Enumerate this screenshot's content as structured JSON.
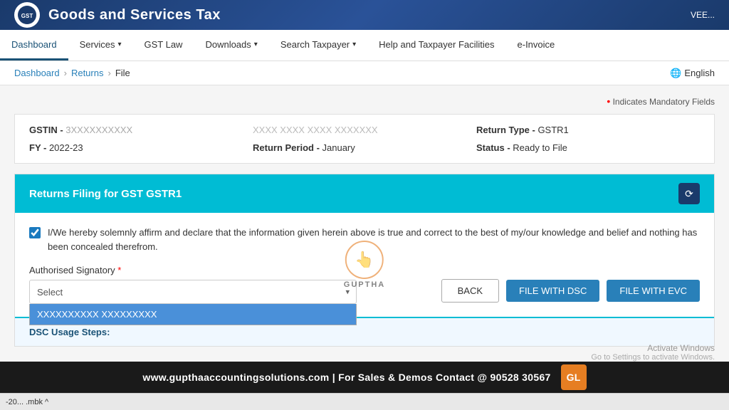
{
  "header": {
    "logo_text": "GST",
    "title": "Goods and Services Tax",
    "user_text": "VEE..."
  },
  "nav": {
    "items": [
      {
        "label": "Dashboard",
        "active": true,
        "has_arrow": false
      },
      {
        "label": "Services",
        "active": false,
        "has_arrow": true
      },
      {
        "label": "GST Law",
        "active": false,
        "has_arrow": false
      },
      {
        "label": "Downloads",
        "active": false,
        "has_arrow": true
      },
      {
        "label": "Search Taxpayer",
        "active": false,
        "has_arrow": true
      },
      {
        "label": "Help and Taxpayer Facilities",
        "active": false,
        "has_arrow": false
      },
      {
        "label": "e-Invoice",
        "active": false,
        "has_arrow": false
      }
    ]
  },
  "breadcrumb": {
    "items": [
      "Dashboard",
      "Returns",
      "File"
    ]
  },
  "language": {
    "label": "English",
    "icon": "🌐"
  },
  "mandatory_notice": "Indicates Mandatory Fields",
  "info": {
    "gstin_label": "GSTIN - ",
    "gstin_value": "3XXXXXXXXXX",
    "return_type_label": "Return Type - ",
    "return_type_value": "GSTR1",
    "fy_label": "FY - ",
    "fy_value": "2022-23",
    "return_period_label": "Return Period - ",
    "return_period_value": "January",
    "status_label": "Status - ",
    "status_value": "Ready to File"
  },
  "returns_filing": {
    "title": "Returns Filing for GST GSTR1",
    "refresh_icon": "⟳",
    "declaration_text": "I/We hereby solemnly affirm and declare that the information given herein above is true and correct to the best of my/our knowledge and belief and nothing has been concealed therefrom.",
    "auth_signatory_label": "Authorised Signatory",
    "required_marker": "*",
    "select_placeholder": "Select",
    "selected_option": "XXXXXXXXXX XXXXXXXXX"
  },
  "buttons": {
    "back": "BACK",
    "file_with_dsc": "FILE WITH DSC",
    "file_with_evc": "FILE WITH EVC"
  },
  "dsc_section": {
    "title": "DSC Usage Steps:"
  },
  "guptha": {
    "hand": "👆",
    "name": "GUPTHA"
  },
  "activate_windows": {
    "line1": "Activate Windows",
    "line2": "Go to Settings to activate Windows."
  },
  "footer": {
    "text": "www.gupthaaccountingsolutions.com | For Sales & Demos Contact @ 90528 30567",
    "logo_text": "GL"
  },
  "taskbar": {
    "left_text": "-20... .mbk  ^"
  }
}
